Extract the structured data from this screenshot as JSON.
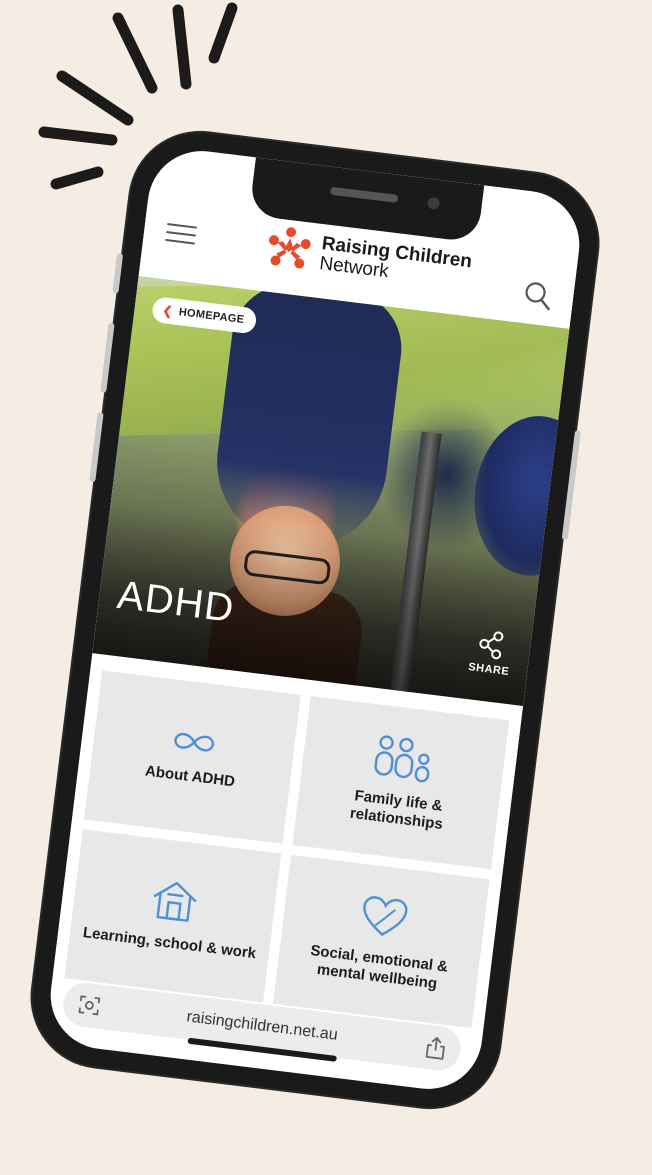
{
  "header": {
    "logo_line1": "Raising Children",
    "logo_line2": "Network",
    "menu_icon": "hamburger-icon",
    "search_icon": "search-icon"
  },
  "hero": {
    "back_label": "HOMEPAGE",
    "title": "ADHD",
    "share_label": "SHARE"
  },
  "tiles": [
    {
      "label": "About ADHD",
      "icon": "infinity-icon"
    },
    {
      "label": "Family life & relationships",
      "icon": "family-icon"
    },
    {
      "label": "Learning, school & work",
      "icon": "school-house-icon"
    },
    {
      "label": "Social, emotional & mental wellbeing",
      "icon": "heart-icon"
    }
  ],
  "browser": {
    "url": "raisingchildren.net.au"
  },
  "colors": {
    "brand": "#e84a2e",
    "icon_blue": "#4f8fd6",
    "background": "#f5ede4",
    "tile_bg": "#e8e8e8"
  }
}
